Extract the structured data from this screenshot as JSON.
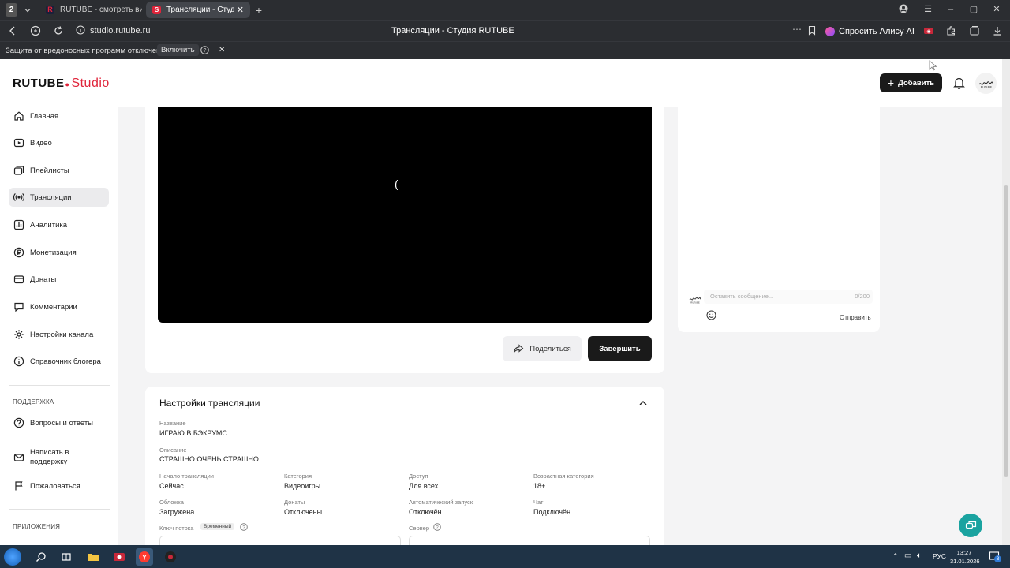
{
  "browser": {
    "tab_counter": "2",
    "tabs": [
      {
        "label": "RUTUBE - смотреть видео"
      },
      {
        "label": "Трансляции - Студия R"
      }
    ],
    "url": "studio.rutube.ru",
    "page_title": "Трансляции - Студия RUTUBE",
    "alice_label": "Спросить Алису AI",
    "warning_text": "Защита от вредоносных программ отключена",
    "enable_label": "Включить"
  },
  "header": {
    "logo_main": "RUTUBE",
    "logo_sub": "Studio",
    "add_label": "Добавить"
  },
  "sidebar": {
    "items": [
      {
        "label": "Главная",
        "icon": "home-icon"
      },
      {
        "label": "Видео",
        "icon": "video-icon"
      },
      {
        "label": "Плейлисты",
        "icon": "playlist-icon"
      },
      {
        "label": "Трансляции",
        "icon": "broadcast-icon"
      },
      {
        "label": "Аналитика",
        "icon": "analytics-icon"
      },
      {
        "label": "Монетизация",
        "icon": "monetization-icon"
      },
      {
        "label": "Донаты",
        "icon": "donate-icon"
      },
      {
        "label": "Комментарии",
        "icon": "comment-icon"
      },
      {
        "label": "Настройки канала",
        "icon": "gear-icon"
      },
      {
        "label": "Справочник блогера",
        "icon": "info-icon"
      }
    ],
    "support_heading": "ПОДДЕРЖКА",
    "support_items": [
      {
        "label": "Вопросы и ответы",
        "icon": "question-icon"
      },
      {
        "label": "Написать в поддержку",
        "icon": "mail-icon"
      },
      {
        "label": "Пожаловаться",
        "icon": "flag-icon"
      }
    ],
    "apps_heading": "ПРИЛОЖЕНИЯ"
  },
  "player": {
    "share_label": "Поделиться",
    "finish_label": "Завершить"
  },
  "chat": {
    "placeholder": "Оставить сообщение...",
    "counter": "0/200",
    "send_label": "Отправить"
  },
  "settings": {
    "title": "Настройки трансляции",
    "name_label": "Название",
    "name_value": "ИГРАЮ В БЭКРУМС",
    "desc_label": "Описание",
    "desc_value": "СТРАШНО ОЧЕНЬ СТРАШНО",
    "fields": [
      {
        "label": "Начало трансляции",
        "value": "Сейчас"
      },
      {
        "label": "Категория",
        "value": "Видеоигры"
      },
      {
        "label": "Доступ",
        "value": "Для всех"
      },
      {
        "label": "Возрастная категория",
        "value": "18+"
      },
      {
        "label": "Обложка",
        "value": "Загружена"
      },
      {
        "label": "Донаты",
        "value": "Отключены"
      },
      {
        "label": "Автоматический запуск",
        "value": "Отключён"
      },
      {
        "label": "Чат",
        "value": "Подключён"
      }
    ],
    "stream_key_label": "Ключ потока",
    "stream_key_badge": "Временный",
    "server_label": "Сервер"
  },
  "taskbar": {
    "time": "13:27",
    "date": "31.01.2026",
    "lang": "РУС",
    "notif": "3"
  },
  "colors": {
    "brand_red": "#e0243a",
    "dark_button": "#1a1a1a",
    "chat_bubble": "#1aa3a0"
  }
}
